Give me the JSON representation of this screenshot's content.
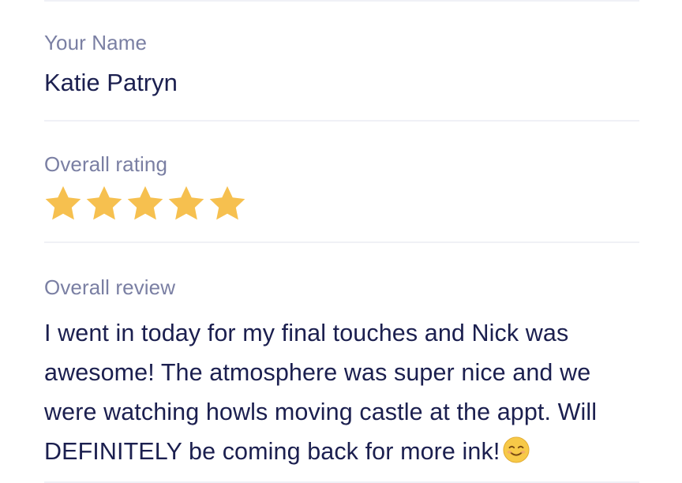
{
  "name_field": {
    "label": "Your Name",
    "value": "Katie Patryn"
  },
  "rating_field": {
    "label": "Overall rating",
    "stars": 5,
    "max_stars": 5,
    "star_color": "#f6c04f"
  },
  "review_field": {
    "label": "Overall review",
    "value": "I went in today for my final touches and Nick was awesome! The atmosphere was super nice and we were watching howls moving castle at the appt. Will DEFINITELY be coming back for more ink!",
    "emoji": "smiling-face-icon"
  },
  "colors": {
    "label": "#7a7fa3",
    "text": "#1b1f4f",
    "divider": "#f0f1f6"
  }
}
